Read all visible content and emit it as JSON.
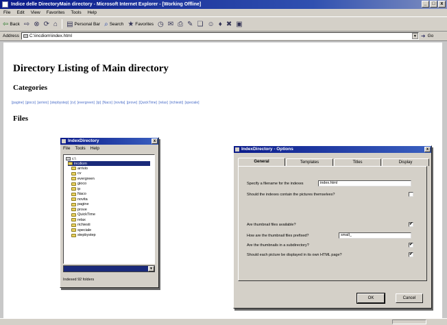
{
  "browser": {
    "title": "Indice delle DirectoryMain directory - Microsoft Internet Explorer - [Working Offline]",
    "window_buttons": [
      "_",
      "□",
      "x"
    ],
    "menu": [
      "File",
      "Edit",
      "View",
      "Favorites",
      "Tools",
      "Help"
    ],
    "toolbar": {
      "back": "Back",
      "personal_bar": "Personal Bar",
      "search": "Search",
      "favorites": "Favorites"
    },
    "address": {
      "label": "Address",
      "value": "C:\\incdiom\\index.html",
      "go": "Go"
    },
    "status": ""
  },
  "page": {
    "title": "Directory Listing of Main directory",
    "categories_heading": "Categories",
    "categories": [
      "[pagine]",
      "[gioco]",
      "[arrivio]",
      "[stepbystep]",
      "[cv]",
      "[evergreen]",
      "[ip]",
      "[Naco]",
      "[novita]",
      "[prove]",
      "[QuickTime]",
      "[relax]",
      "[richiesti]",
      "[speciale]"
    ],
    "files_heading": "Files"
  },
  "index_window": {
    "title": "IndexDirectory",
    "menu": [
      "File",
      "Tools",
      "Help"
    ],
    "root": "c:\\",
    "selected": "incdiom",
    "folders": [
      "arrivio",
      "cv",
      "evergreen",
      "gioco",
      "ip",
      "Naco",
      "novita",
      "pagine",
      "prove",
      "QuickTime",
      "relax",
      "richiesti",
      "speciale",
      "stepbystep"
    ],
    "status": "Indexed 92 folders"
  },
  "options_window": {
    "title": "IndexDirectory - Options",
    "tabs": [
      "General",
      "Templates",
      "Titles",
      "Display"
    ],
    "active_tab": "General",
    "fields": {
      "filename_label": "Specify a filename for the indexes",
      "filename_value": "index.html",
      "contain_pictures_label": "Should the indexes contain the pictures themselves?",
      "thumbnails_available_label": "Are thumbnail files available?",
      "thumb_prefix_label": "How are the thumbnail files prefixed?",
      "thumb_prefix_value": "small_",
      "thumb_subdir_label": "Are the thumbnails in a subdirectory?",
      "own_page_label": "Should each picture be displayed in its own HTML page?"
    },
    "checkbox_glyph": "✔",
    "ok": "OK",
    "cancel": "Cancel"
  }
}
